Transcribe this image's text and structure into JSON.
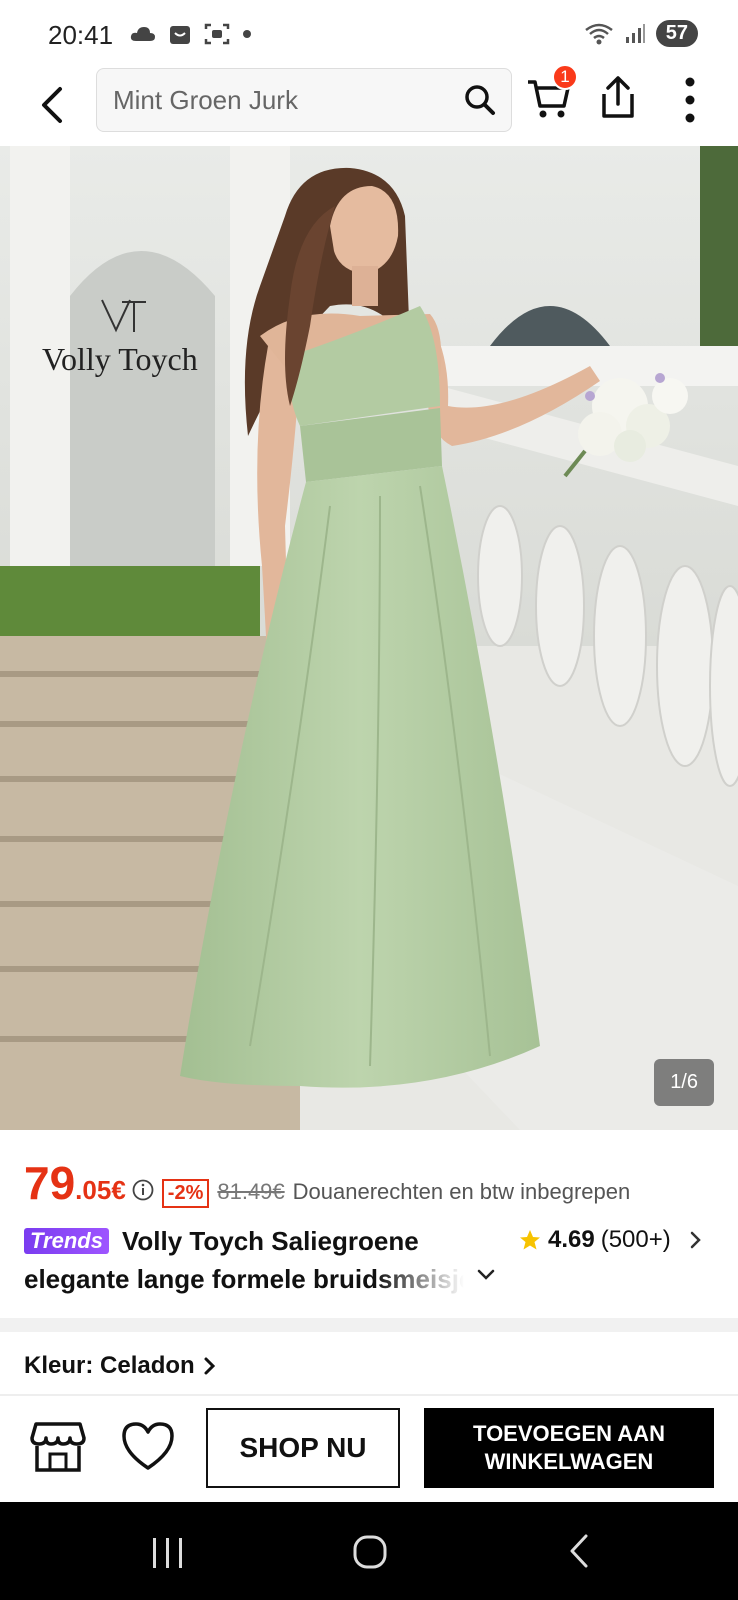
{
  "status_bar": {
    "time": "20:41",
    "battery": "57"
  },
  "header": {
    "search_text": "Mint Groen Jurk",
    "cart_count": "1"
  },
  "image": {
    "brand_watermark": "Volly Toych",
    "brand_monogram": "VT",
    "counter": "1/6"
  },
  "price": {
    "main": "79",
    "decimal": ".05€",
    "discount": "-2%",
    "old_price": "81.49€",
    "tax_note": "Douanerechten en btw inbegrepen"
  },
  "product": {
    "badge": "Trends",
    "title_line1": "Volly Toych Saliegroene",
    "title_line2": "elegante lange formele bruidsmeisjes",
    "rating": "4.69",
    "review_count": "(500+)"
  },
  "color": {
    "label": "Kleur: Celadon"
  },
  "actions": {
    "shop_now": "SHOP NU",
    "add_to_cart": "TOEVOEGEN AAN WINKELWAGEN"
  },
  "colors": {
    "accent_red": "#e53214",
    "dress_green": "#b6cfa6",
    "trends_purple": "#8a45f5"
  }
}
